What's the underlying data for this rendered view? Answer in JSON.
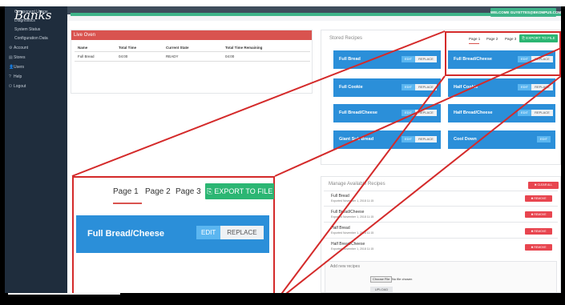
{
  "sidebar": {
    "logo": "Banks",
    "items": [
      {
        "label": "Component Usage",
        "icon": ""
      },
      {
        "label": "Diagnostics",
        "icon": ""
      },
      {
        "label": "System Status",
        "icon": ""
      },
      {
        "label": "Configuration Data",
        "icon": ""
      },
      {
        "label": "Account",
        "icon": "⚙"
      },
      {
        "label": "Stores",
        "icon": "▤"
      },
      {
        "label": "Users",
        "icon": "👤"
      },
      {
        "label": "Help",
        "icon": "?"
      },
      {
        "label": "Logout",
        "icon": "⏻"
      }
    ]
  },
  "header": {
    "welcome": "WELCOME GUYETTES@BKOMPUS.COM ▾"
  },
  "live_oven": {
    "title": "Live Oven",
    "columns": [
      "Name",
      "Total Time",
      "Current State",
      "Total Time Remaining"
    ],
    "row": [
      "Full Bread",
      "04:00",
      "READY",
      "04:00"
    ]
  },
  "stored_recipes": {
    "title": "Stored Recipes",
    "pages": [
      "Page 1",
      "Page 2",
      "Page 3"
    ],
    "export_label": "EXPORT TO FILE",
    "export_icon": "export-icon",
    "edit_label": "EDIT",
    "replace_label": "REPLACE",
    "tiles": [
      {
        "name": "Full Bread"
      },
      {
        "name": "Full Bread/Cheese"
      },
      {
        "name": "Full Cookie"
      },
      {
        "name": "Half Cookie"
      },
      {
        "name": "Full Bread/Cheese"
      },
      {
        "name": "Half Bread/Cheese"
      },
      {
        "name": "Giant Sub Bread"
      },
      {
        "name": "Cool Down"
      }
    ]
  },
  "manage": {
    "title": "Manage Available Recipes",
    "clear_all": "✖ CLEAR ALL",
    "remove_label": "✖ REMOVE",
    "items": [
      {
        "name": "Full Bread",
        "exported": "Exported November 1, 2018 11:15"
      },
      {
        "name": "Full Bread/Cheese",
        "exported": "Exported November 1, 2018 11:15"
      },
      {
        "name": "Half Bread",
        "exported": "Exported November 1, 2018 11:15"
      },
      {
        "name": "Half Bread/Cheese",
        "exported": "Exported November 1, 2018 11:15"
      }
    ],
    "add_title": "Add new recipes",
    "choose_file": "Choose File",
    "no_file": "No file chosen",
    "upload": "UPLOAD"
  },
  "zoom": {
    "pages": [
      "Page 1",
      "Page 2",
      "Page 3"
    ],
    "export_label": "EXPORT TO FILE",
    "tile_name": "Full Bread/Cheese",
    "edit_label": "EDIT",
    "replace_label": "REPLACE"
  },
  "colors": {
    "sidebar": "#1f2d3d",
    "accent_green": "#2bb673",
    "live_red": "#d9534f",
    "tile_blue": "#2b8fd9",
    "callout_red": "#d42a2a"
  }
}
